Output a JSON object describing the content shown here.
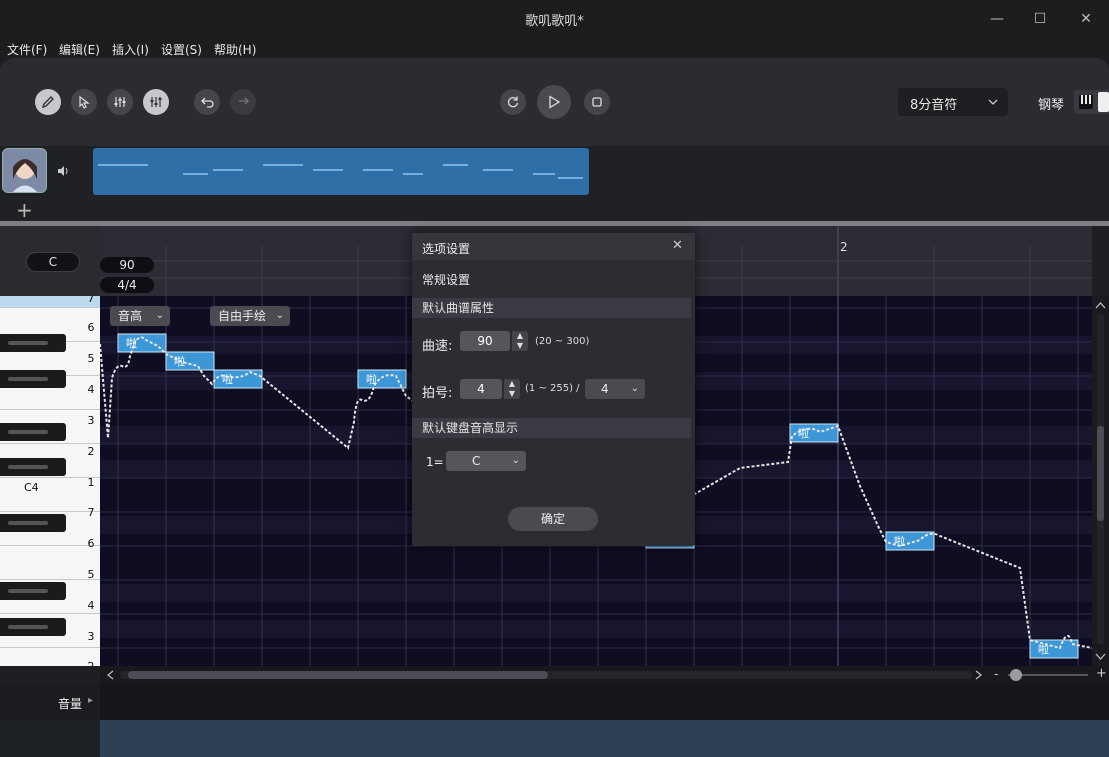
{
  "window": {
    "title": "歌叽歌叽*",
    "minimize": "—",
    "maximize": "☐",
    "close": "✕"
  },
  "menu": [
    "文件(F)",
    "编辑(E)",
    "插入(I)",
    "设置(S)",
    "帮助(H)"
  ],
  "toolbar": {
    "note_length": "8分音符",
    "instrument": "钢琴"
  },
  "track": {
    "add": "+"
  },
  "ruler": {
    "key": "C",
    "tempo": "90",
    "time_signature": "4/4",
    "measure_2": "2"
  },
  "piano": {
    "degrees": [
      "7",
      "6",
      "5",
      "4",
      "3",
      "2",
      "1",
      "7",
      "6",
      "5",
      "4",
      "3",
      "2"
    ],
    "c4_label": "C4"
  },
  "grid_controls": {
    "mode": "音高",
    "draw": "自由手绘"
  },
  "notes": [
    {
      "lyric": "啦"
    },
    {
      "lyric": "啦"
    },
    {
      "lyric": "啦"
    },
    {
      "lyric": "啦"
    },
    {
      "lyric": "啦"
    },
    {
      "lyric": "啦"
    },
    {
      "lyric": "啦"
    }
  ],
  "volume": {
    "label": "音量",
    "arrow": "▸"
  },
  "zoom": {
    "minus": "-",
    "plus": "+"
  },
  "dialog": {
    "title": "选项设置",
    "close": "✕",
    "general": "常规设置",
    "default_props": "默认曲谱属性",
    "tempo_label": "曲速:",
    "tempo_value": "90",
    "tempo_range": "(20 ~ 300)",
    "beat_label": "拍号:",
    "beat_value": "4",
    "beat_range": "(1 ~ 255) /",
    "beat_denominator": "4",
    "keyboard_display": "默认键盘音高显示",
    "key_prefix": "1=",
    "key_value": "C",
    "ok": "确定"
  },
  "colors": {
    "note": "#3d97d6",
    "clip": "#2e6fa7",
    "grid": "#0e0d22"
  }
}
